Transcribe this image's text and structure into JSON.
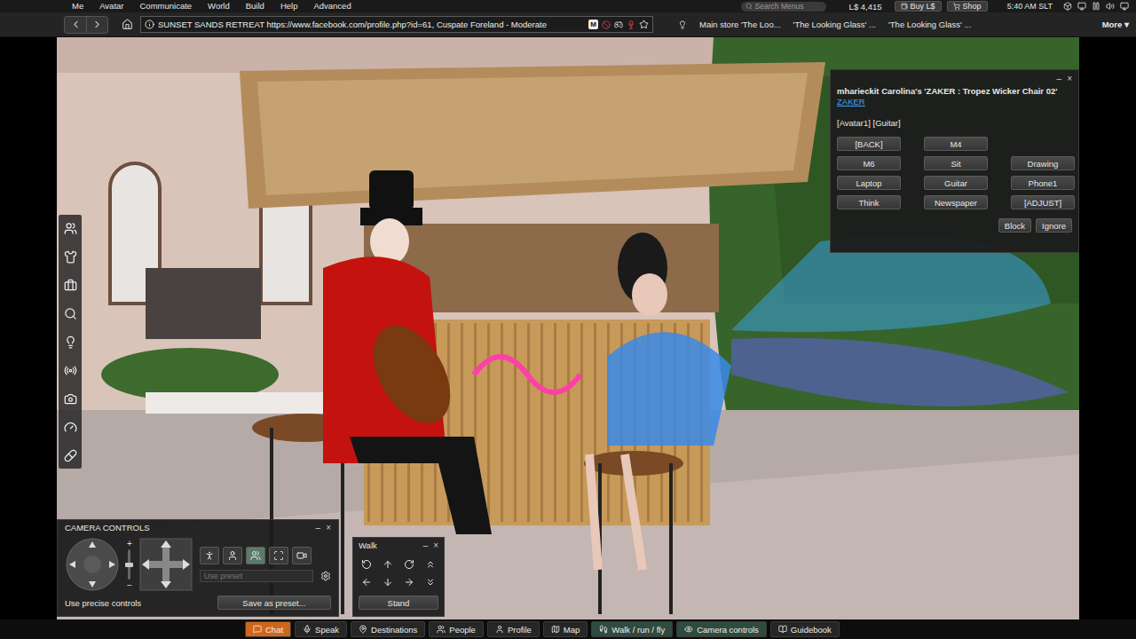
{
  "menu_bar": {
    "items": [
      "Me",
      "Avatar",
      "Communicate",
      "World",
      "Build",
      "Help",
      "Advanced"
    ],
    "search": {
      "placeholder": "Search Menus"
    },
    "balance": "L$ 4,415",
    "buy_button": "Buy L$",
    "shop_button": "Shop",
    "time": "5:40 AM SLT"
  },
  "nav_bar": {
    "location": "SUNSET SANDS RETREAT https://www.facebook.com/profile.php?id=61, Cuspate Foreland - Moderate",
    "maturity_badge": "M",
    "bookmarked": false
  },
  "favorites": {
    "items": [
      "Main store 'The Loo...",
      "'The Looking Glass' ...",
      "'The Looking Glass' ..."
    ],
    "more": "More ▾"
  },
  "dialog": {
    "title": "mharieckit Carolina's 'ZAKER : Tropez Wicker Chair 02'",
    "link": "ZAKER",
    "message": "[Avatar1] [Guitar]",
    "window_controls": [
      "–",
      "×"
    ],
    "buttons": [
      [
        "[BACK]",
        "M4",
        null
      ],
      [
        "M6",
        "Sit",
        "Drawing"
      ],
      [
        "Laptop",
        "Guitar",
        "Phone1"
      ],
      [
        "Think",
        "Newspaper",
        "[ADJUST]"
      ]
    ],
    "footer_buttons": [
      "Block",
      "Ignore"
    ]
  },
  "camera_controls": {
    "title": "CAMERA CONTROLS",
    "window_controls": [
      "–",
      "×"
    ],
    "zoom": {
      "in": "+",
      "out": "−",
      "level": 0.5
    },
    "modes": [
      {
        "selected": false
      },
      {
        "selected": false
      },
      {
        "selected": true
      },
      {
        "selected": false
      },
      {
        "selected": false
      }
    ],
    "preset": {
      "placeholder": "Use preset",
      "disabled": true
    },
    "precise_label": "Use precise controls",
    "save_button": "Save as preset..."
  },
  "walk_panel": {
    "title": "Walk",
    "window_controls": [
      "–",
      "×"
    ],
    "stand_button": "Stand"
  },
  "bottom_bar": {
    "buttons": [
      {
        "label": "Chat",
        "selected": false,
        "flashing": true
      },
      {
        "label": "Speak",
        "selected": false,
        "flashing": false
      },
      {
        "label": "Destinations",
        "selected": false,
        "flashing": false
      },
      {
        "label": "People",
        "selected": false,
        "flashing": false
      },
      {
        "label": "Profile",
        "selected": false,
        "flashing": false
      },
      {
        "label": "Map",
        "selected": false,
        "flashing": false
      },
      {
        "label": "Walk / run / fly",
        "selected": true,
        "flashing": false
      },
      {
        "label": "Camera controls",
        "selected": true,
        "flashing": false
      },
      {
        "label": "Guidebook",
        "selected": false,
        "flashing": false
      }
    ]
  }
}
